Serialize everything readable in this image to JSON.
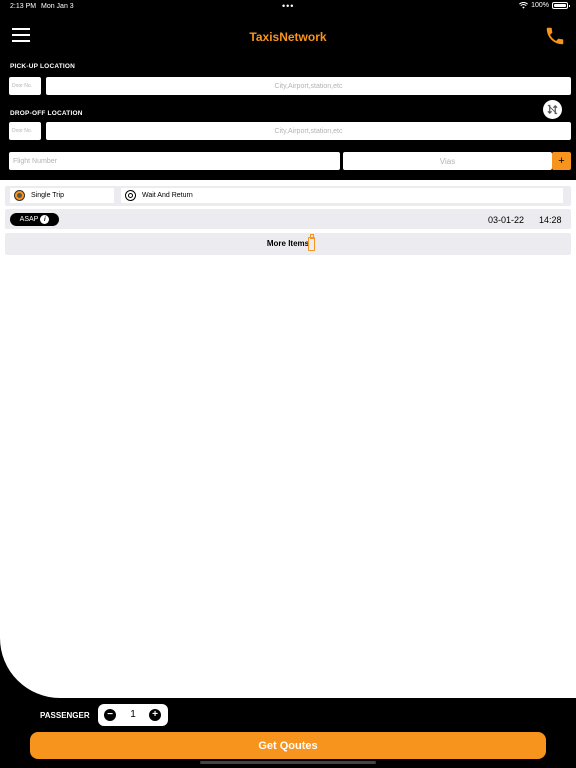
{
  "status_bar": {
    "time": "2:13 PM",
    "date": "Mon Jan 3",
    "battery": "100%"
  },
  "header": {
    "title": "TaxisNetwork"
  },
  "pickup": {
    "label": "PICK-UP LOCATION",
    "door_placeholder": "Door No.",
    "location_placeholder": "City,Airport,station,etc"
  },
  "dropoff": {
    "label": "DROP-OFF LOCATION",
    "door_placeholder": "Door No.",
    "location_placeholder": "City,Airport,station,etc"
  },
  "flight": {
    "placeholder": "Flight Number"
  },
  "vias": {
    "placeholder": "Vias",
    "add_label": "+"
  },
  "trip_type": {
    "options": [
      "Single Trip",
      "Wait And Return"
    ],
    "selected": "Single Trip"
  },
  "schedule": {
    "asap_label": "ASAP",
    "date": "03-01-22",
    "time": "14:28"
  },
  "more_items": {
    "label": "More Items"
  },
  "passenger": {
    "label": "PASSENGER",
    "count": "1",
    "minus": "−",
    "plus": "+"
  },
  "cta": {
    "label": "Get Qoutes"
  },
  "colors": {
    "accent": "#f7941d",
    "background": "#000000",
    "panel": "#ffffff"
  }
}
